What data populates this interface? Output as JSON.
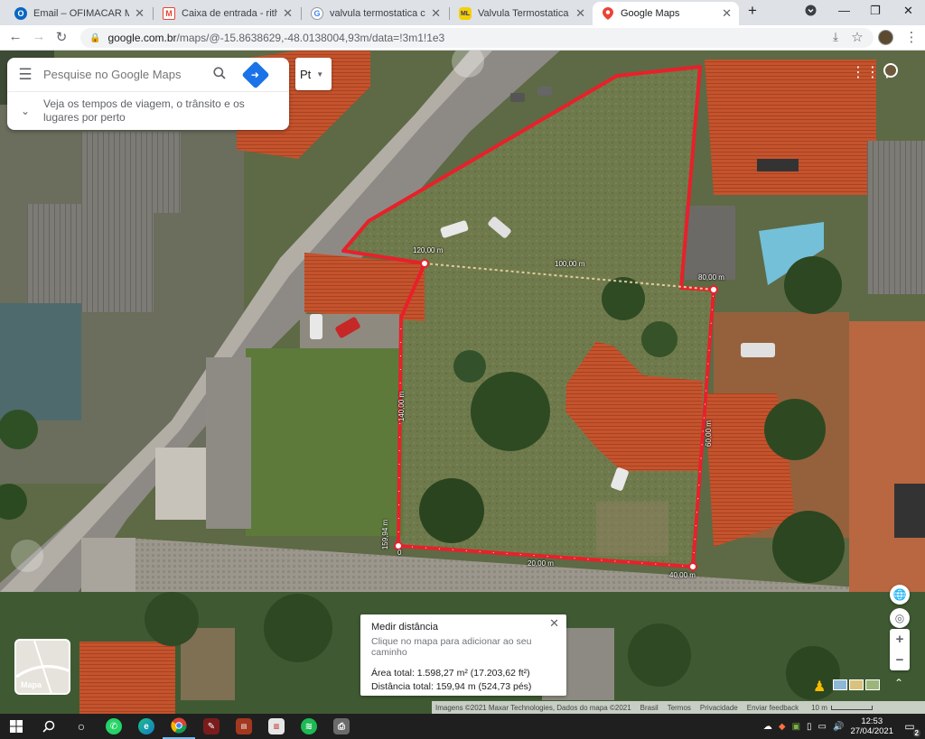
{
  "tabs": [
    {
      "title": "Email – OFIMACAR MULTI",
      "favicon": "outlook-icon",
      "color": "#0a66c2",
      "glyph": "O",
      "active": false
    },
    {
      "title": "Caixa de entrada - rithiely",
      "favicon": "gmail-icon",
      "color": "#ea4335",
      "glyph": "M",
      "active": false
    },
    {
      "title": "valvula termostatica chev",
      "favicon": "google-icon",
      "color": "#4285f4",
      "glyph": "G",
      "active": false
    },
    {
      "title": "Valvula Termostatica Chev",
      "favicon": "mercadolivre-icon",
      "color": "#f5d000",
      "glyph": "ML",
      "active": false
    },
    {
      "title": "Google Maps",
      "favicon": "maps-pin-icon",
      "color": "#34a853",
      "glyph": "●",
      "active": true
    }
  ],
  "toolbar": {
    "url_host": "google.com.br",
    "url_path": "/maps/@-15.8638629,-48.0138004,93m/data=!3m1!1e3"
  },
  "search": {
    "placeholder": "Pesquise no Google Maps",
    "travel_tip": "Veja os tempos de viagem, o trânsito e os lugares por perto"
  },
  "language_button": "Pt",
  "measure_card": {
    "title": "Medir distância",
    "hint": "Clique no mapa para adicionar ao seu caminho",
    "area": "Área total: 1.598,27 m² (17.203,62 ft²)",
    "distance": "Distância total: 159,94 m (524,73 pés)"
  },
  "map_labels": {
    "l120": "120,00 m",
    "l100": "100,00 m",
    "l80": "80,00 m",
    "l140": "140,00 m",
    "l60": "60,00 m",
    "l15994": "159,94 m",
    "l20": "20,00 m",
    "l40": "40,00 m",
    "l0": "0"
  },
  "minimap_label": "Mapa",
  "footer": {
    "imagery": "Imagens ©2021 Maxar Technologies, Dados do mapa ©2021",
    "country": "Brasil",
    "terms": "Termos",
    "privacy": "Privacidade",
    "feedback": "Enviar feedback",
    "scale": "10 m"
  },
  "taskbar": {
    "time": "12:53",
    "date": "27/04/2021",
    "notifications": "2",
    "apps": [
      {
        "name": "windows-start-icon",
        "glyph": "⊞",
        "color": "#ffffff"
      },
      {
        "name": "search-icon",
        "glyph": "⚲",
        "color": "#ffffff"
      },
      {
        "name": "task-view-icon",
        "glyph": "○",
        "color": "#ffffff"
      },
      {
        "name": "whatsapp-icon",
        "glyph": "W",
        "color": "#25d366"
      },
      {
        "name": "edge-icon",
        "glyph": "e",
        "color": "#0f7dc2"
      },
      {
        "name": "chrome-icon",
        "glyph": "◉",
        "color": "#db4437"
      },
      {
        "name": "tool-app-icon",
        "glyph": "✎",
        "color": "#c0392b"
      },
      {
        "name": "app-red-icon",
        "glyph": "▤",
        "color": "#a3381f"
      },
      {
        "name": "app-white-icon",
        "glyph": "▥",
        "color": "#d8d8d8"
      },
      {
        "name": "spotify-icon",
        "glyph": "♫",
        "color": "#1db954"
      },
      {
        "name": "printer-app-icon",
        "glyph": "⎙",
        "color": "#9e9e9e"
      }
    ]
  },
  "colors": {
    "measure_line": "#e8202a",
    "chrome_tabstrip": "#dee1e6"
  }
}
